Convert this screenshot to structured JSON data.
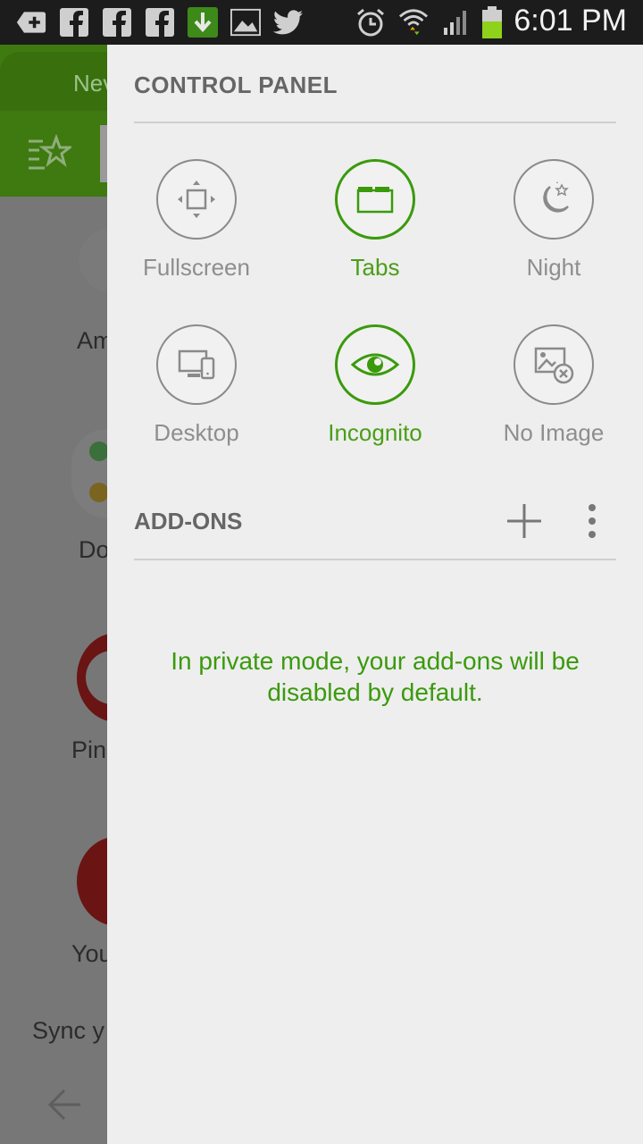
{
  "status_bar": {
    "time": "6:01 PM",
    "icons": [
      "add-notification-icon",
      "facebook-icon",
      "facebook-icon",
      "facebook-icon",
      "download-icon",
      "image-icon",
      "twitter-icon",
      "alarm-icon",
      "wifi-icon",
      "signal-icon",
      "battery-icon"
    ]
  },
  "background": {
    "tab_label": "Nev",
    "items": [
      "Am",
      "Do",
      "Pin",
      "You",
      "Sync y"
    ]
  },
  "control_panel": {
    "title": "CONTROL PANEL",
    "tiles": [
      {
        "label": "Fullscreen",
        "icon": "fullscreen-icon",
        "active": false
      },
      {
        "label": "Tabs",
        "icon": "tabs-icon",
        "active": true
      },
      {
        "label": "Night",
        "icon": "night-icon",
        "active": false
      },
      {
        "label": "Desktop",
        "icon": "desktop-icon",
        "active": false
      },
      {
        "label": "Incognito",
        "icon": "incognito-icon",
        "active": true
      },
      {
        "label": "No Image",
        "icon": "no-image-icon",
        "active": false
      }
    ]
  },
  "addons": {
    "title": "ADD-ONS",
    "private_message": "In private mode, your add-ons will be disabled by default."
  },
  "colors": {
    "accent": "#3a9a0c",
    "panel_bg": "#eeeeee",
    "status_bar": "#1c1c1c"
  }
}
